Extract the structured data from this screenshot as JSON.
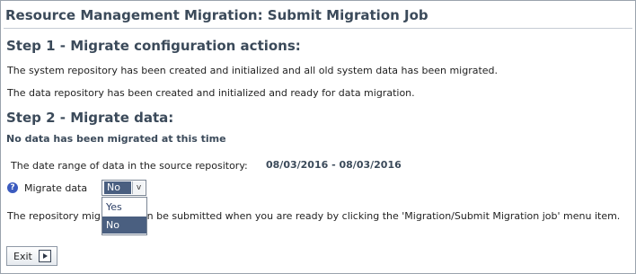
{
  "page": {
    "title": "Resource Management Migration: Submit Migration Job"
  },
  "step1": {
    "heading": "Step 1 - Migrate configuration actions:",
    "line1": "The system repository has been created and initialized and all old system data has been migrated.",
    "line2": "The data repository has been created and initialized and ready for data migration."
  },
  "step2": {
    "heading": "Step 2 - Migrate data:",
    "status": "No data has been migrated at this time",
    "date_range_label": "The date range of data in the source repository:",
    "date_range_value": "08/03/2016 - 08/03/2016",
    "migrate_label": "Migrate data",
    "migrate_selected": "No",
    "migrate_options": [
      "Yes",
      "No"
    ],
    "repo_text_prefix": "The repository mig",
    "repo_text_suffix": "can be submitted when you are ready by clicking the 'Migration/Submit Migration job' menu item."
  },
  "buttons": {
    "exit_label": "Exit"
  },
  "icons": {
    "help": "help-circle-icon",
    "dropdown_arrow": "chevron-down-icon",
    "exit": "arrow-right-icon"
  },
  "colors": {
    "heading": "#3b4a5a",
    "selected_option": "#4a5f80",
    "help_icon": "#3b5bbf"
  }
}
